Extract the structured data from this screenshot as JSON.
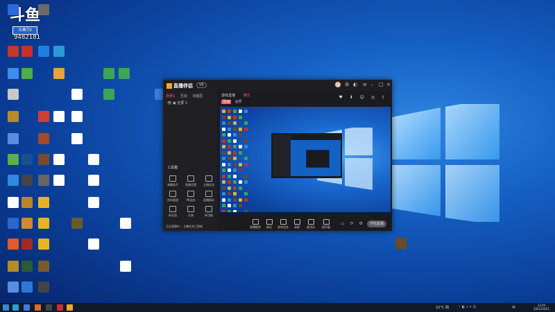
{
  "overlay": {
    "cn_title": "斗鱼",
    "sub": "斗鱼TV",
    "room_number": "9482181"
  },
  "desktop_icons": [
    {
      "label": "",
      "color": "#2b6ad8"
    },
    {
      "label": "",
      "color": "#6a6a6a"
    },
    {
      "label": "",
      "color": "#c0392b"
    },
    {
      "label": "",
      "color": "#c9302c"
    },
    {
      "label": "",
      "color": "#1c7fe0"
    },
    {
      "label": "",
      "color": "#2a9bd8"
    },
    {
      "label": "",
      "color": "#3d8ee8"
    },
    {
      "label": "",
      "color": "#4cae4c"
    },
    {
      "label": "",
      "color": "#e8a33d"
    },
    {
      "label": "",
      "color": "#3aa655"
    },
    {
      "label": "",
      "color": "#3aa655"
    },
    {
      "label": "",
      "color": "#c8c8c8"
    },
    {
      "label": "",
      "color": "#ffffff"
    },
    {
      "label": "",
      "color": "#3aa655"
    },
    {
      "label": "",
      "color": "#3d7ae0"
    },
    {
      "label": "",
      "color": "#b88a2a"
    },
    {
      "label": "",
      "color": "#4cc06a"
    },
    {
      "label": "",
      "color": "#d04030"
    },
    {
      "label": "",
      "color": "#ffffff"
    },
    {
      "label": "",
      "color": "#ffffff"
    },
    {
      "label": "",
      "color": "#5a8de0"
    },
    {
      "label": "",
      "color": "#a04a2a"
    },
    {
      "label": "",
      "color": "#ffffff"
    },
    {
      "label": "",
      "color": "#5ab04a"
    },
    {
      "label": "",
      "color": "#1a4f8c"
    },
    {
      "label": "",
      "color": "#7a4a2a"
    },
    {
      "label": "",
      "color": "#ffffff"
    },
    {
      "label": "",
      "color": "#ffffff"
    },
    {
      "label": "",
      "color": "#2d8ae0"
    },
    {
      "label": "",
      "color": "#444"
    },
    {
      "label": "",
      "color": "#666"
    },
    {
      "label": "",
      "color": "#ffffff"
    },
    {
      "label": "",
      "color": "#ffffff"
    },
    {
      "label": "",
      "color": "#ffffff"
    },
    {
      "label": "",
      "color": "#b8872a"
    },
    {
      "label": "",
      "color": "#e6b422"
    },
    {
      "label": "",
      "color": "#ffffff"
    },
    {
      "label": "",
      "color": "#2a66d0"
    },
    {
      "label": "",
      "color": "#d08a2a"
    },
    {
      "label": "",
      "color": "#e6b422"
    },
    {
      "label": "",
      "color": "#6a5a2a"
    },
    {
      "label": "",
      "color": "#ffffff"
    },
    {
      "label": "",
      "color": "#e05a2a"
    },
    {
      "label": "",
      "color": "#a02a2a"
    },
    {
      "label": "",
      "color": "#e6b422"
    },
    {
      "label": "",
      "color": "#ffffff"
    },
    {
      "label": "",
      "color": "#b88a2a"
    },
    {
      "label": "",
      "color": "#2a5a3a"
    },
    {
      "label": "",
      "color": "#7a5a2a"
    },
    {
      "label": "",
      "color": "#ffffff"
    },
    {
      "label": "",
      "color": "#5a8de0"
    },
    {
      "label": "",
      "color": "#2a7ad0"
    },
    {
      "label": "",
      "color": "#444"
    },
    {
      "label": "",
      "color": "#6a4a2a"
    }
  ],
  "app": {
    "logo": "直播伴侣",
    "version": "V6",
    "left_tabs": [
      "场景1",
      "互动",
      "功能区"
    ],
    "scene_label": "全屏 1",
    "tools_title": "工具箱",
    "tools": [
      "弹幕助手",
      "直播设置",
      "主播任务",
      "房间管理",
      "PK连线",
      "直播精彩",
      "粉丝团",
      "礼物",
      "新功能"
    ],
    "stream_title": "游戏直播",
    "stream_tags": [
      "娱乐",
      "互动",
      "画质"
    ],
    "controls": [
      "直播推荐",
      "高光",
      "发布任务",
      "录屏",
      "麦克风",
      "扬声器"
    ],
    "go_live": "开始直播",
    "status_text": "正在直播中... 主播任务已更新"
  },
  "taskbar": {
    "weather": "22°C 阴",
    "lang": "中",
    "time": "13:45",
    "date": "2021/10/21"
  }
}
